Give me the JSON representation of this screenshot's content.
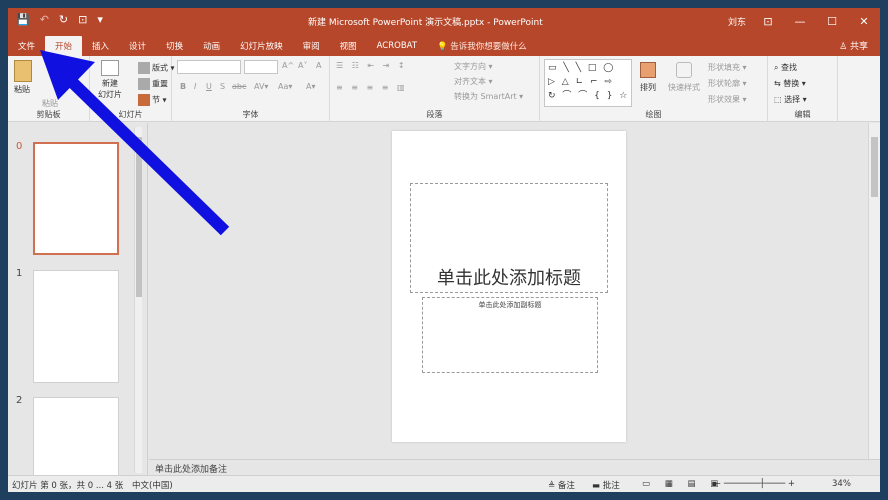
{
  "titlebar": {
    "qat": {
      "save": "💾",
      "undo": "↶",
      "redo": "↻",
      "start_from_beginning": "⊡",
      "customize": "▾"
    },
    "document_title": "新建 Microsoft PowerPoint 演示文稿.pptx  -  PowerPoint",
    "user": "刘东",
    "window_controls": {
      "ribbon_options": "⊡",
      "minimize": "—",
      "maximize": "☐",
      "close": "✕"
    }
  },
  "tabs": [
    "文件",
    "开始",
    "插入",
    "设计",
    "切换",
    "动画",
    "幻灯片放映",
    "审阅",
    "视图",
    "ACROBAT"
  ],
  "tell_me": "💡 告诉我你想要做什么",
  "share": "♙ 共享",
  "ribbon": {
    "clipboard": {
      "paste": "粘贴",
      "paste_special": "粘贴",
      "label": "剪贴板"
    },
    "slides": {
      "new_slide": "新建",
      "new_slide_2": "幻灯片",
      "layout": "版式 ▾",
      "reset": "重置",
      "section": "节 ▾",
      "label": "幻灯片"
    },
    "font": {
      "label": "字体",
      "bold": "B",
      "italic": "I",
      "underline": "U",
      "shadow": "S",
      "strikethrough": "abc",
      "spacing": "AV▾",
      "case": "Aa▾",
      "color": "A▾",
      "grow": "A^",
      "shrink": "A˅",
      "clear": "A"
    },
    "paragraph": {
      "label": "段落",
      "text_direction": "文字方向 ▾",
      "align_text": "对齐文本 ▾",
      "smartart": "转换为 SmartArt ▾"
    },
    "drawing": {
      "shapes": "▭ ╲ ╲ □ ◯\n▷ △ ∟ ⌐ ⇨\n↻ ⌒ ⌒ { } ☆",
      "arrange": "排列",
      "quick_styles": "快速样式",
      "shape_fill": "形状填充 ▾",
      "shape_outline": "形状轮廓 ▾",
      "shape_effects": "形状效果 ▾",
      "label": "绘图"
    },
    "editing": {
      "find": "查找",
      "replace": "替换 ▾",
      "select": "选择 ▾",
      "label": "编辑"
    }
  },
  "thumbnails": [
    {
      "num": "0",
      "selected": true
    },
    {
      "num": "1",
      "selected": false
    },
    {
      "num": "2",
      "selected": false
    }
  ],
  "slide": {
    "title_placeholder": "单击此处添加标题",
    "subtitle_placeholder": "单击此处添加副标题"
  },
  "notes_placeholder": "单击此处添加备注",
  "status": {
    "slide_info": "幻灯片 第 0 张，共 0 ... 4 张",
    "language": "中文(中国)",
    "notes": "备注",
    "comments": "批注",
    "zoom": "34%"
  },
  "annotation": {
    "color": "#1010e0"
  },
  "accent": "#b7472a"
}
